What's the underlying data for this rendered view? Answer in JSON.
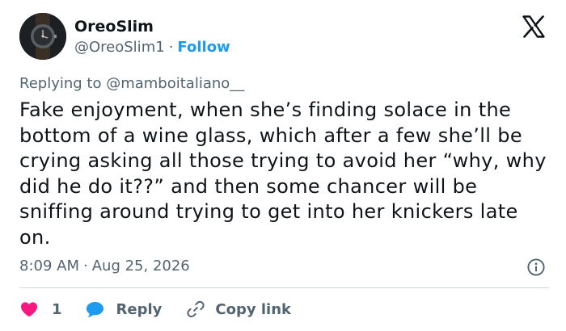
{
  "author": {
    "display_name": "OreoSlim",
    "handle": "@OreoSlim1",
    "separator": "·",
    "follow_label": "Follow"
  },
  "reply_context": {
    "prefix": "Replying to ",
    "mention": "@mamboitaliano__"
  },
  "tweet": {
    "text": "Fake enjoyment, when she’s finding solace in the bottom of a wine glass, which after a few she’ll be crying asking all those trying to avoid her “why, why did he do it??” and then some chancer will be sniffing around trying to get into her knickers late on."
  },
  "meta": {
    "time": "8:09 AM",
    "separator": "·",
    "date": "Aug 25, 2026"
  },
  "actions": {
    "like_count": "1",
    "reply_label": "Reply",
    "copy_link_label": "Copy link"
  },
  "icons": {
    "brand": "x-logo-icon",
    "info": "info-icon",
    "like": "heart-icon",
    "reply": "speech-bubble-icon",
    "copy": "link-icon"
  },
  "colors": {
    "text_primary": "#0f1419",
    "text_secondary": "#536471",
    "link": "#1d9bf0",
    "like": "#f91880",
    "reply": "#1d9bf0",
    "divider": "#cfd9de"
  }
}
